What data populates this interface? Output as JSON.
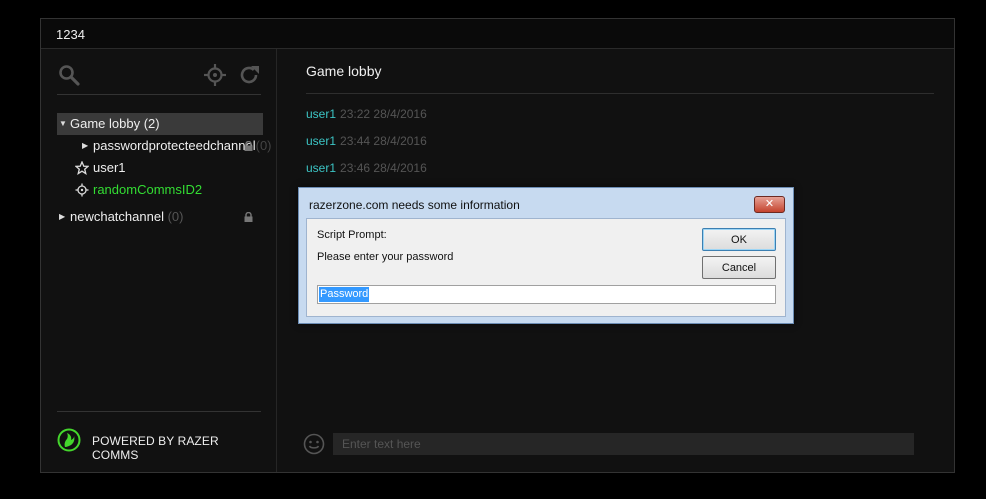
{
  "window": {
    "title": "1234"
  },
  "sidebar": {
    "tree": [
      {
        "label": "Game lobby",
        "count": "(2)",
        "expanded": true,
        "selected": true
      },
      {
        "label": "passwordprotecteedchannel",
        "count": "(0)",
        "locked": true
      },
      {
        "label": "user1",
        "icon": "star-outline-icon"
      },
      {
        "label": "randomCommsID2",
        "icon": "crosshair-icon"
      },
      {
        "label": "newchatchannel",
        "count": "(0)",
        "locked": true
      }
    ],
    "powered_by": "POWERED BY RAZER COMMS"
  },
  "channel": {
    "title": "Game lobby",
    "messages": [
      {
        "user": "user1",
        "time": "23:22 28/4/2016"
      },
      {
        "user": "user1",
        "time": "23:44 28/4/2016"
      },
      {
        "user": "user1",
        "time": "23:46 28/4/2016"
      }
    ],
    "input_placeholder": "Enter text here"
  },
  "dialog": {
    "title": "razerzone.com needs some information",
    "close_label": "✕",
    "prompt_label": "Script Prompt:",
    "message": "Please enter your password",
    "ok_label": "OK",
    "cancel_label": "Cancel",
    "input_value": "Password"
  },
  "colors": {
    "user_name": "#3cc5c5",
    "active_user": "#33dd33",
    "razer_green": "#44d62c"
  }
}
